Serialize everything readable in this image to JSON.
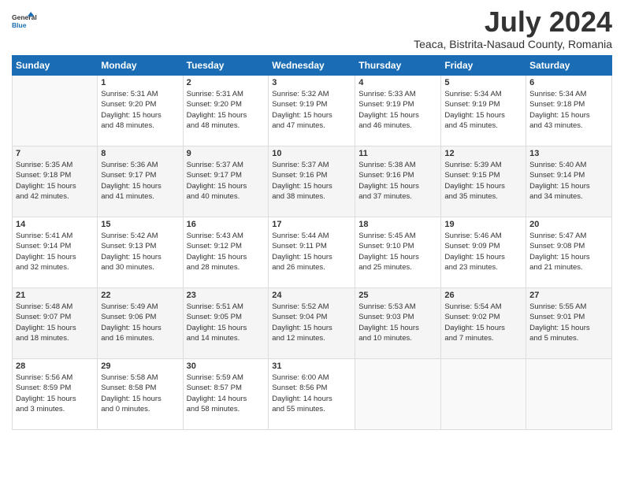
{
  "logo": {
    "line1": "General",
    "line2": "Blue"
  },
  "title": "July 2024",
  "subtitle": "Teaca, Bistrita-Nasaud County, Romania",
  "weekdays": [
    "Sunday",
    "Monday",
    "Tuesday",
    "Wednesday",
    "Thursday",
    "Friday",
    "Saturday"
  ],
  "weeks": [
    [
      null,
      {
        "day": 1,
        "sunrise": "5:31 AM",
        "sunset": "9:20 PM",
        "daylight": "15 hours and 48 minutes."
      },
      {
        "day": 2,
        "sunrise": "5:31 AM",
        "sunset": "9:20 PM",
        "daylight": "15 hours and 48 minutes."
      },
      {
        "day": 3,
        "sunrise": "5:32 AM",
        "sunset": "9:19 PM",
        "daylight": "15 hours and 47 minutes."
      },
      {
        "day": 4,
        "sunrise": "5:33 AM",
        "sunset": "9:19 PM",
        "daylight": "15 hours and 46 minutes."
      },
      {
        "day": 5,
        "sunrise": "5:34 AM",
        "sunset": "9:19 PM",
        "daylight": "15 hours and 45 minutes."
      },
      {
        "day": 6,
        "sunrise": "5:34 AM",
        "sunset": "9:18 PM",
        "daylight": "15 hours and 43 minutes."
      }
    ],
    [
      {
        "day": 7,
        "sunrise": "5:35 AM",
        "sunset": "9:18 PM",
        "daylight": "15 hours and 42 minutes."
      },
      {
        "day": 8,
        "sunrise": "5:36 AM",
        "sunset": "9:17 PM",
        "daylight": "15 hours and 41 minutes."
      },
      {
        "day": 9,
        "sunrise": "5:37 AM",
        "sunset": "9:17 PM",
        "daylight": "15 hours and 40 minutes."
      },
      {
        "day": 10,
        "sunrise": "5:37 AM",
        "sunset": "9:16 PM",
        "daylight": "15 hours and 38 minutes."
      },
      {
        "day": 11,
        "sunrise": "5:38 AM",
        "sunset": "9:16 PM",
        "daylight": "15 hours and 37 minutes."
      },
      {
        "day": 12,
        "sunrise": "5:39 AM",
        "sunset": "9:15 PM",
        "daylight": "15 hours and 35 minutes."
      },
      {
        "day": 13,
        "sunrise": "5:40 AM",
        "sunset": "9:14 PM",
        "daylight": "15 hours and 34 minutes."
      }
    ],
    [
      {
        "day": 14,
        "sunrise": "5:41 AM",
        "sunset": "9:14 PM",
        "daylight": "15 hours and 32 minutes."
      },
      {
        "day": 15,
        "sunrise": "5:42 AM",
        "sunset": "9:13 PM",
        "daylight": "15 hours and 30 minutes."
      },
      {
        "day": 16,
        "sunrise": "5:43 AM",
        "sunset": "9:12 PM",
        "daylight": "15 hours and 28 minutes."
      },
      {
        "day": 17,
        "sunrise": "5:44 AM",
        "sunset": "9:11 PM",
        "daylight": "15 hours and 26 minutes."
      },
      {
        "day": 18,
        "sunrise": "5:45 AM",
        "sunset": "9:10 PM",
        "daylight": "15 hours and 25 minutes."
      },
      {
        "day": 19,
        "sunrise": "5:46 AM",
        "sunset": "9:09 PM",
        "daylight": "15 hours and 23 minutes."
      },
      {
        "day": 20,
        "sunrise": "5:47 AM",
        "sunset": "9:08 PM",
        "daylight": "15 hours and 21 minutes."
      }
    ],
    [
      {
        "day": 21,
        "sunrise": "5:48 AM",
        "sunset": "9:07 PM",
        "daylight": "15 hours and 18 minutes."
      },
      {
        "day": 22,
        "sunrise": "5:49 AM",
        "sunset": "9:06 PM",
        "daylight": "15 hours and 16 minutes."
      },
      {
        "day": 23,
        "sunrise": "5:51 AM",
        "sunset": "9:05 PM",
        "daylight": "15 hours and 14 minutes."
      },
      {
        "day": 24,
        "sunrise": "5:52 AM",
        "sunset": "9:04 PM",
        "daylight": "15 hours and 12 minutes."
      },
      {
        "day": 25,
        "sunrise": "5:53 AM",
        "sunset": "9:03 PM",
        "daylight": "15 hours and 10 minutes."
      },
      {
        "day": 26,
        "sunrise": "5:54 AM",
        "sunset": "9:02 PM",
        "daylight": "15 hours and 7 minutes."
      },
      {
        "day": 27,
        "sunrise": "5:55 AM",
        "sunset": "9:01 PM",
        "daylight": "15 hours and 5 minutes."
      }
    ],
    [
      {
        "day": 28,
        "sunrise": "5:56 AM",
        "sunset": "8:59 PM",
        "daylight": "15 hours and 3 minutes."
      },
      {
        "day": 29,
        "sunrise": "5:58 AM",
        "sunset": "8:58 PM",
        "daylight": "15 hours and 0 minutes."
      },
      {
        "day": 30,
        "sunrise": "5:59 AM",
        "sunset": "8:57 PM",
        "daylight": "14 hours and 58 minutes."
      },
      {
        "day": 31,
        "sunrise": "6:00 AM",
        "sunset": "8:56 PM",
        "daylight": "14 hours and 55 minutes."
      },
      null,
      null,
      null
    ]
  ]
}
